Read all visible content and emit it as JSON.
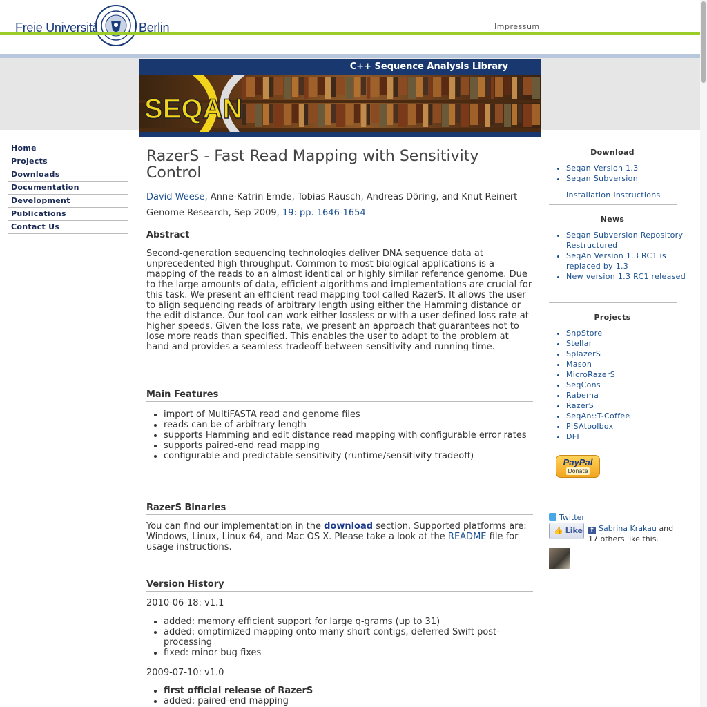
{
  "header": {
    "university_left": "Freie Universität",
    "university_right": "Berlin",
    "impressum": "Impressum"
  },
  "banner": {
    "tagline": "C++ Sequence Analysis Library",
    "logo_text": "SEQAN"
  },
  "leftnav": {
    "items": [
      {
        "label": "Home"
      },
      {
        "label": "Projects"
      },
      {
        "label": "Downloads"
      },
      {
        "label": "Documentation"
      },
      {
        "label": "Development"
      },
      {
        "label": "Publications"
      },
      {
        "label": "Contact Us"
      }
    ]
  },
  "main": {
    "title": "RazerS - Fast Read Mapping with Sensitivity Control",
    "author_link": "David Weese",
    "authors_rest": ", Anne-Katrin Emde, Tobias Rausch, Andreas Döring, and Knut Reinert",
    "venue_text": "Genome Research, Sep 2009, ",
    "venue_link": "19: pp. 1646-1654",
    "abstract_heading": "Abstract",
    "abstract_text": "Second-generation sequencing technologies deliver DNA sequence data at unprecedented high throughput. Common to most biological applications is a mapping of the reads to an almost identical or highly similar reference genome. Due to the large amounts of data, efficient algorithms and implementations are crucial for this task. We present an efficient read mapping tool called RazerS. It allows the user to align sequencing reads of arbitrary length using either the Hamming distance or the edit distance. Our tool can work either lossless or with a user-defined loss rate at higher speeds. Given the loss rate, we present an approach that guarantees not to lose more reads than specified. This enables the user to adapt to the problem at hand and provides a seamless tradeoff between sensitivity and running time.",
    "features_heading": "Main Features",
    "features": [
      "import of MultiFASTA read and genome files",
      "reads can be of arbitrary length",
      "supports Hamming and edit distance read mapping with configurable error rates",
      "supports paired-end read mapping",
      "configurable and predictable sensitivity (runtime/sensitivity tradeoff)"
    ],
    "binaries_heading": "RazerS Binaries",
    "binaries_pre": "You can find our implementation in the ",
    "binaries_link": "download",
    "binaries_mid": " section. Supported platforms are: Windows, Linux, Linux 64, and Mac OS X. Please take a look at the ",
    "binaries_readme": "README",
    "binaries_post": " file for usage instructions.",
    "history_heading": "Version History",
    "v11_label": "2010-06-18: v1.1",
    "v11_items": [
      "added: memory efficient support for large q-grams (up to 31)",
      "added: omptimized mapping onto many short contigs, deferred Swift post-processing",
      "fixed: minor bug fixes"
    ],
    "v10_label": "2009-07-10: v1.0",
    "v10_item_bold": "first official release of RazerS",
    "v10_item2": "added: paired-end mapping"
  },
  "sidebar": {
    "download_heading": "Download",
    "download_links": [
      "Seqan Version 1.3",
      "Seqan Subversion"
    ],
    "install_link": "Installation Instructions",
    "news_heading": "News",
    "news_links": [
      "Seqan Subversion Repository Restructured",
      "SeqAn Version 1.3 RC1 is replaced by 1.3",
      "New version 1.3 RC1 released"
    ],
    "projects_heading": "Projects",
    "projects": [
      "SnpStore",
      "Stellar",
      "SplazerS",
      "Mason",
      "MicroRazerS",
      "SeqCons",
      "Rabema",
      "RazerS",
      "SeqAn::T-Coffee",
      "PISAtoolbox",
      "DFI"
    ],
    "paypal_label": "PayPal",
    "paypal_donate": "Donate",
    "twitter_label": "Twitter",
    "like_label": "Like",
    "fb_name": "Sabrina Krakau",
    "fb_and": " and",
    "fb_rest": "17 others like this."
  }
}
